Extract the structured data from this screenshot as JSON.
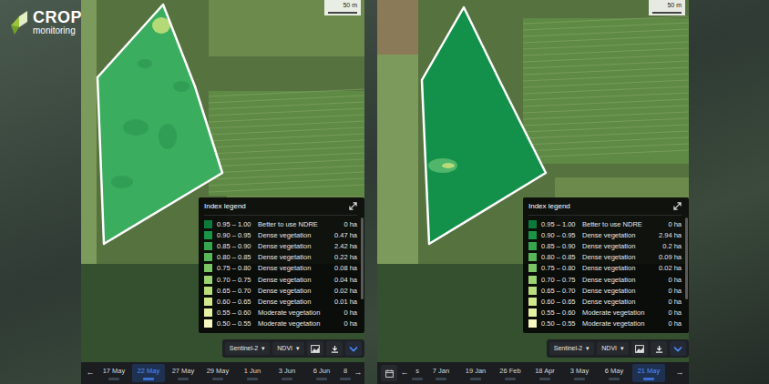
{
  "logo": {
    "line1": "CROP",
    "line2": "monitoring"
  },
  "panels": [
    {
      "scale": "50 m",
      "field": {
        "color": "#3aad5e"
      },
      "legend": {
        "title": "Index legend",
        "rows": [
          {
            "range": "0.95 – 1.00",
            "label": "Better to use NDRE",
            "area": "0 ha",
            "color": "#0b7a3b"
          },
          {
            "range": "0.90 – 0.95",
            "label": "Dense vegetation",
            "area": "0.47 ha",
            "color": "#1a9445"
          },
          {
            "range": "0.85 – 0.90",
            "label": "Dense vegetation",
            "area": "2.42 ha",
            "color": "#35a64e"
          },
          {
            "range": "0.80 – 0.85",
            "label": "Dense vegetation",
            "area": "0.22 ha",
            "color": "#58b758"
          },
          {
            "range": "0.75 – 0.80",
            "label": "Dense vegetation",
            "area": "0.08 ha",
            "color": "#7cc564"
          },
          {
            "range": "0.70 – 0.75",
            "label": "Dense vegetation",
            "area": "0.04 ha",
            "color": "#9cd26f"
          },
          {
            "range": "0.65 – 0.70",
            "label": "Dense vegetation",
            "area": "0.02 ha",
            "color": "#b9de7b"
          },
          {
            "range": "0.60 – 0.65",
            "label": "Dense vegetation",
            "area": "0.01 ha",
            "color": "#d1e98a"
          },
          {
            "range": "0.55 – 0.60",
            "label": "Moderate vegetation",
            "area": "0 ha",
            "color": "#e6f2a2"
          },
          {
            "range": "0.50 – 0.55",
            "label": "Moderate vegetation",
            "area": "0 ha",
            "color": "#f6f8bf"
          }
        ]
      },
      "toolbar": {
        "satellite": "Sentinel-2",
        "index": "NDVI",
        "caret": "▾"
      },
      "dates": {
        "has_calendar": false,
        "prev": "←",
        "next": "→",
        "items": [
          {
            "label": "17 May",
            "selected": false,
            "cut": false
          },
          {
            "label": "22 May",
            "selected": true,
            "cut": false
          },
          {
            "label": "27 May",
            "selected": false,
            "cut": false
          },
          {
            "label": "29 May",
            "selected": false,
            "cut": false
          },
          {
            "label": "1 Jun",
            "selected": false,
            "cut": false
          },
          {
            "label": "3 Jun",
            "selected": false,
            "cut": false
          },
          {
            "label": "6 Jun",
            "selected": false,
            "cut": false
          },
          {
            "label": "8",
            "selected": false,
            "cut": true
          }
        ]
      }
    },
    {
      "scale": "50 m",
      "field": {
        "color": "#13914a"
      },
      "legend": {
        "title": "Index legend",
        "rows": [
          {
            "range": "0.95 – 1.00",
            "label": "Better to use NDRE",
            "area": "0 ha",
            "color": "#0b7a3b"
          },
          {
            "range": "0.90 – 0.95",
            "label": "Dense vegetation",
            "area": "2.94 ha",
            "color": "#1a9445"
          },
          {
            "range": "0.85 – 0.90",
            "label": "Dense vegetation",
            "area": "0.2 ha",
            "color": "#35a64e"
          },
          {
            "range": "0.80 – 0.85",
            "label": "Dense vegetation",
            "area": "0.09 ha",
            "color": "#58b758"
          },
          {
            "range": "0.75 – 0.80",
            "label": "Dense vegetation",
            "area": "0.02 ha",
            "color": "#7cc564"
          },
          {
            "range": "0.70 – 0.75",
            "label": "Dense vegetation",
            "area": "0 ha",
            "color": "#9cd26f"
          },
          {
            "range": "0.65 – 0.70",
            "label": "Dense vegetation",
            "area": "0 ha",
            "color": "#b9de7b"
          },
          {
            "range": "0.60 – 0.65",
            "label": "Dense vegetation",
            "area": "0 ha",
            "color": "#d1e98a"
          },
          {
            "range": "0.55 – 0.60",
            "label": "Moderate vegetation",
            "area": "0 ha",
            "color": "#e6f2a2"
          },
          {
            "range": "0.50 – 0.55",
            "label": "Moderate vegetation",
            "area": "0 ha",
            "color": "#f6f8bf"
          }
        ]
      },
      "toolbar": {
        "satellite": "Sentinel-2",
        "index": "NDVI",
        "caret": "▾"
      },
      "dates": {
        "has_calendar": true,
        "prev": "←",
        "next": "→",
        "items": [
          {
            "label": "s",
            "selected": false,
            "cut": true
          },
          {
            "label": "7 Jan",
            "selected": false,
            "cut": false
          },
          {
            "label": "19 Jan",
            "selected": false,
            "cut": false
          },
          {
            "label": "26 Feb",
            "selected": false,
            "cut": false
          },
          {
            "label": "18 Apr",
            "selected": false,
            "cut": false
          },
          {
            "label": "3 May",
            "selected": false,
            "cut": false
          },
          {
            "label": "6 May",
            "selected": false,
            "cut": false
          },
          {
            "label": "21 May",
            "selected": true,
            "cut": false
          }
        ]
      }
    }
  ]
}
